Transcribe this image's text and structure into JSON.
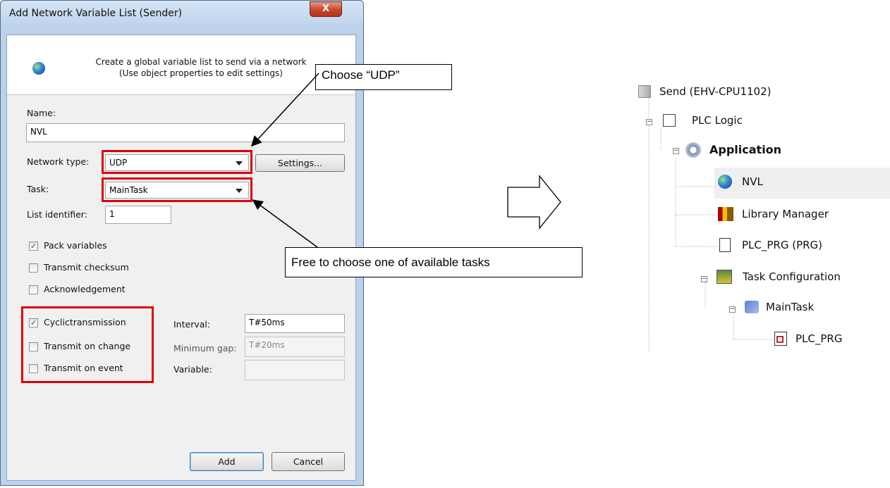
{
  "dialog": {
    "title": "Add Network Variable List (Sender)",
    "close_glyph": "X",
    "header_line1": "Create a global variable list to send via a network",
    "header_line2": "(Use object properties to edit settings)",
    "name_label": "Name:",
    "name_value": "NVL",
    "network_type_label": "Network type:",
    "network_type_value": "UDP",
    "settings_button": "Settings...",
    "task_label": "Task:",
    "task_value": "MainTask",
    "list_identifier_label": "List identifier:",
    "list_identifier_value": "1",
    "checkboxes": [
      {
        "label": "Pack variables",
        "checked": true
      },
      {
        "label": "Transmit checksum",
        "checked": false
      },
      {
        "label": "Acknowledgement",
        "checked": false
      },
      {
        "label": "Cyclictransmission",
        "checked": true
      },
      {
        "label": "Transmit on change",
        "checked": false
      },
      {
        "label": "Transmit on event",
        "checked": false
      }
    ],
    "interval_label": "Interval:",
    "interval_value": "T#50ms",
    "min_gap_label": "Minimum gap:",
    "min_gap_value": "T#20ms",
    "variable_label": "Variable:",
    "variable_value": "",
    "add_button": "Add",
    "cancel_button": "Cancel"
  },
  "callouts": {
    "choose_udp": "Choose “UDP”",
    "free_task": "Free to choose one of available tasks"
  },
  "tree": {
    "root": "Send (EHV-CPU1102)",
    "plc_logic": "PLC Logic",
    "application": "Application",
    "nvl": "NVL",
    "library_manager": "Library Manager",
    "plc_prg": "PLC_PRG (PRG)",
    "task_configuration": "Task Configuration",
    "main_task": "MainTask",
    "plc_prg_call": "PLC_PRG"
  },
  "colors": {
    "highlight_red": "#e0000a",
    "dialog_frame": "#bcd2ea",
    "selected_row": "#efefef"
  }
}
